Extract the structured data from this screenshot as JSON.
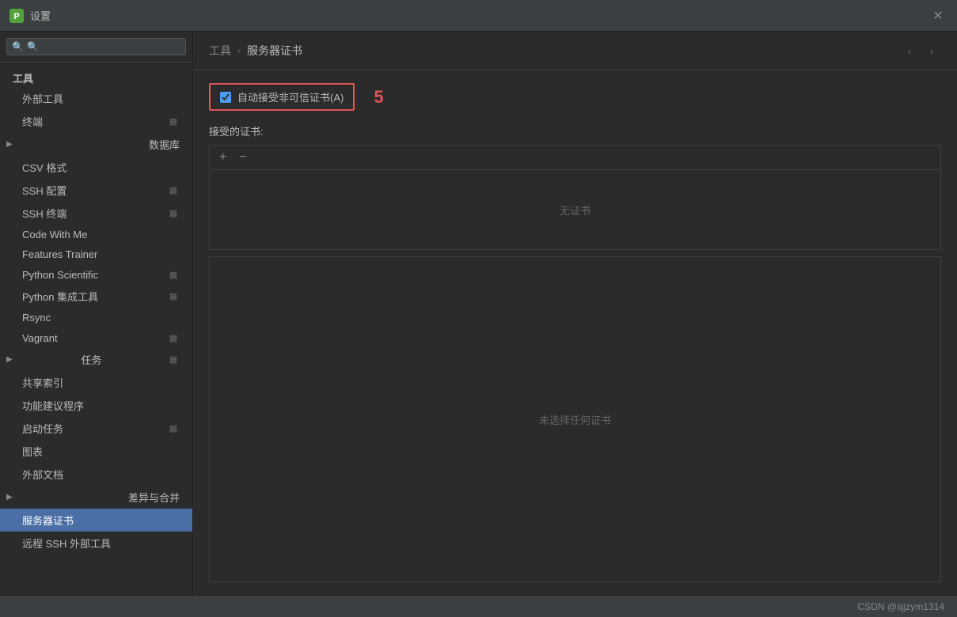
{
  "window": {
    "title": "设置",
    "close_label": "✕"
  },
  "search": {
    "placeholder": "🔍",
    "value": ""
  },
  "sidebar": {
    "section_tools": "工具",
    "items": [
      {
        "id": "external-tools",
        "label": "外部工具",
        "indent": 2,
        "has_arrow": false,
        "has_icon_right": false
      },
      {
        "id": "terminal",
        "label": "终端",
        "indent": 2,
        "has_arrow": false,
        "has_icon_right": true
      },
      {
        "id": "database",
        "label": "数据库",
        "indent": 1,
        "has_arrow": true,
        "has_icon_right": false
      },
      {
        "id": "csv-format",
        "label": "CSV 格式",
        "indent": 2,
        "has_arrow": false,
        "has_icon_right": false
      },
      {
        "id": "ssh-config",
        "label": "SSH 配置",
        "indent": 2,
        "has_arrow": false,
        "has_icon_right": true
      },
      {
        "id": "ssh-terminal",
        "label": "SSH 终端",
        "indent": 2,
        "has_arrow": false,
        "has_icon_right": true
      },
      {
        "id": "code-with-me",
        "label": "Code With Me",
        "indent": 2,
        "has_arrow": false,
        "has_icon_right": false
      },
      {
        "id": "features-trainer",
        "label": "Features Trainer",
        "indent": 2,
        "has_arrow": false,
        "has_icon_right": false
      },
      {
        "id": "python-scientific",
        "label": "Python Scientific",
        "indent": 2,
        "has_arrow": false,
        "has_icon_right": true
      },
      {
        "id": "python-integration",
        "label": "Python 集成工具",
        "indent": 2,
        "has_arrow": false,
        "has_icon_right": true
      },
      {
        "id": "rsync",
        "label": "Rsync",
        "indent": 2,
        "has_arrow": false,
        "has_icon_right": false
      },
      {
        "id": "vagrant",
        "label": "Vagrant",
        "indent": 2,
        "has_arrow": false,
        "has_icon_right": true
      },
      {
        "id": "tasks",
        "label": "任务",
        "indent": 1,
        "has_arrow": true,
        "has_icon_right": true
      },
      {
        "id": "shared-index",
        "label": "共享索引",
        "indent": 2,
        "has_arrow": false,
        "has_icon_right": false
      },
      {
        "id": "feature-suggest",
        "label": "功能建议程序",
        "indent": 2,
        "has_arrow": false,
        "has_icon_right": false
      },
      {
        "id": "startup-tasks",
        "label": "启动任务",
        "indent": 2,
        "has_arrow": false,
        "has_icon_right": true
      },
      {
        "id": "chart",
        "label": "图表",
        "indent": 2,
        "has_arrow": false,
        "has_icon_right": false
      },
      {
        "id": "external-docs",
        "label": "外部文档",
        "indent": 2,
        "has_arrow": false,
        "has_icon_right": false
      },
      {
        "id": "diff-merge",
        "label": "差异与合并",
        "indent": 1,
        "has_arrow": true,
        "has_icon_right": false
      },
      {
        "id": "server-cert",
        "label": "服务器证书",
        "indent": 2,
        "has_arrow": false,
        "has_icon_right": false,
        "active": true
      },
      {
        "id": "remote-ssh",
        "label": "远程 SSH 外部工具",
        "indent": 2,
        "has_arrow": false,
        "has_icon_right": false
      }
    ]
  },
  "breadcrumb": {
    "parent": "工具",
    "separator": "›",
    "current": "服务器证书"
  },
  "content": {
    "checkbox_label": "自动接受非可信证书(A)",
    "badge_number": "5",
    "section_received": "接受的证书:",
    "add_btn": "+",
    "remove_btn": "−",
    "no_cert_text": "无证书",
    "no_cert_selected_text": "未选择任何证书"
  },
  "footer": {
    "text": "CSDN @sjjzym1314"
  },
  "icons": {
    "search": "🔍",
    "arrow_right": "›",
    "arrow_left": "‹",
    "expand": "▶",
    "expand_down": "▼",
    "settings_icon": "⚙",
    "monitor_icon": "▦"
  }
}
